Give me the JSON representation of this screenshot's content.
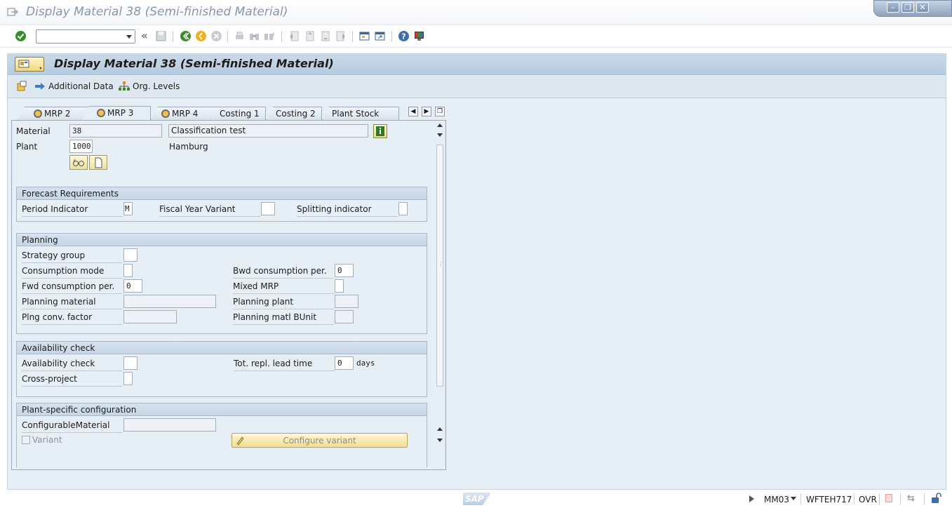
{
  "window": {
    "title": "Display Material 38 (Semi-finished Material)"
  },
  "header": {
    "title": "Display Material 38 (Semi-finished Material)"
  },
  "appbar": {
    "additional_data": "Additional Data",
    "org_levels": "Org. Levels"
  },
  "tabs": [
    {
      "label": "MRP 2",
      "icon": "status-icon",
      "active": false
    },
    {
      "label": "MRP 3",
      "icon": "status-icon",
      "active": true
    },
    {
      "label": "MRP 4",
      "icon": "status-icon",
      "active": false
    },
    {
      "label": "Costing 1",
      "active": false
    },
    {
      "label": "Costing 2",
      "active": false
    },
    {
      "label": "Plant Stock",
      "active": false
    }
  ],
  "material": {
    "material_label": "Material",
    "material_value": "38",
    "description": "Classification test",
    "plant_label": "Plant",
    "plant_value": "1000",
    "plant_name": "Hamburg"
  },
  "forecast": {
    "title": "Forecast Requirements",
    "period_indicator_label": "Period Indicator",
    "period_indicator_value": "M",
    "fiscal_year_variant_label": "Fiscal Year Variant",
    "splitting_indicator_label": "Splitting indicator"
  },
  "planning": {
    "title": "Planning",
    "strategy_group_label": "Strategy group",
    "consumption_mode_label": "Consumption mode",
    "bwd_consumption_label": "Bwd consumption per.",
    "bwd_consumption_value": "0",
    "fwd_consumption_label": "Fwd consumption per.",
    "fwd_consumption_value": "0",
    "mixed_mrp_label": "Mixed MRP",
    "planning_material_label": "Planning material",
    "planning_plant_label": "Planning plant",
    "plng_conv_factor_label": "Plng conv. factor",
    "planning_matl_bunit_label": "Planning matl BUnit"
  },
  "availability": {
    "title": "Availability check",
    "availability_check_label": "Availability check",
    "tot_repl_lead_time_label": "Tot. repl. lead time",
    "tot_repl_lead_time_value": "0",
    "days_label": "days",
    "cross_project_label": "Cross-project"
  },
  "plant_config": {
    "title": "Plant-specific configuration",
    "configurable_material_label": "ConfigurableMaterial",
    "variant_label": "Variant",
    "configure_variant_button": "Configure variant"
  },
  "status": {
    "transaction": "MM03",
    "server": "WFTEH717",
    "mode": "OVR",
    "logo": "SAP"
  },
  "colors": {
    "header_bg": "#c4d5e6",
    "panel_bg": "#e6eef6",
    "accent_green": "#3a8a2e",
    "button_yellow": "#f5dc86"
  }
}
